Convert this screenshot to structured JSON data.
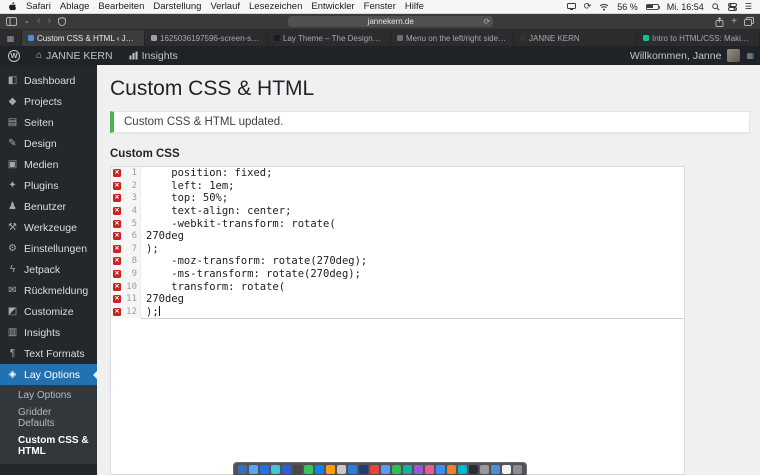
{
  "colors": {
    "wp_blue": "#2271b1",
    "notice_green": "#46b450",
    "error_red": "#cc2222"
  },
  "menubar": {
    "menus": [
      "Safari",
      "Ablage",
      "Bearbeiten",
      "Darstellung",
      "Verlauf",
      "Lesezeichen",
      "Entwickler",
      "Fenster",
      "Hilfe"
    ],
    "status_icons": [
      "display-icon",
      "sync-icon",
      "wifi-icon",
      "battery-icon",
      "spotlight-icon",
      "control-center-icon",
      "notification-icon"
    ],
    "battery": "56 %",
    "clock": "Mi. 16:54"
  },
  "browser": {
    "address": "jannekern.de",
    "tabs": [
      {
        "title": "Custom CSS & HTML ‹ JANN...",
        "color": "#4a90d9",
        "active": true,
        "name": "custom-css-html"
      },
      {
        "title": "1625036197596-screen-shot...",
        "color": "#9aa0a6",
        "name": "screenshot-image"
      },
      {
        "title": "Lay Theme – The Designer's...",
        "color": "#1c1c1e",
        "name": "lay-theme"
      },
      {
        "title": "Menu on the left/right side! |...",
        "color": "#6e6e73",
        "name": "menu-left-right-side"
      },
      {
        "title": "JANNE KERN",
        "color": "#333336",
        "name": "janne-kern"
      },
      {
        "title": "Intro to HTML/CSS: Making w...",
        "color": "#14bf96",
        "name": "intro-html-css"
      }
    ]
  },
  "adminbar": {
    "site_name": "JANNE KERN",
    "insights_label": "Insights",
    "welcome": "Willkommen, Janne"
  },
  "sidebar": {
    "items": [
      {
        "label": "Dashboard",
        "icon": "◧",
        "icon_name": "dashboard-icon",
        "name": "dashboard"
      },
      {
        "label": "Projects",
        "icon": "◆",
        "icon_name": "projects-icon",
        "name": "projects"
      },
      {
        "label": "Seiten",
        "icon": "▤",
        "icon_name": "pages-icon",
        "name": "seiten"
      },
      {
        "label": "Design",
        "icon": "✎",
        "icon_name": "design-icon",
        "name": "design"
      },
      {
        "label": "Medien",
        "icon": "▣",
        "icon_name": "media-icon",
        "name": "medien"
      },
      {
        "label": "Plugins",
        "icon": "✦",
        "icon_name": "plugins-icon",
        "name": "plugins"
      },
      {
        "label": "Benutzer",
        "icon": "♟",
        "icon_name": "users-icon",
        "name": "benutzer"
      },
      {
        "label": "Werkzeuge",
        "icon": "⚒",
        "icon_name": "tools-icon",
        "name": "werkzeuge"
      },
      {
        "label": "Einstellungen",
        "icon": "⚙",
        "icon_name": "settings-icon",
        "name": "einstellungen"
      },
      {
        "label": "Jetpack",
        "icon": "ϟ",
        "icon_name": "jetpack-icon",
        "name": "jetpack"
      },
      {
        "label": "Rückmeldung",
        "icon": "✉",
        "icon_name": "feedback-icon",
        "name": "rueckmeldung"
      },
      {
        "label": "Customize",
        "icon": "◩",
        "icon_name": "customize-icon",
        "name": "customize"
      },
      {
        "label": "Insights",
        "icon": "▥",
        "icon_name": "insights-icon",
        "name": "insights"
      },
      {
        "label": "Text Formats",
        "icon": "¶",
        "icon_name": "text-formats-icon",
        "name": "text-formats"
      },
      {
        "label": "Lay Options",
        "icon": "◈",
        "icon_name": "lay-options-icon",
        "name": "lay-options",
        "active": true
      }
    ],
    "submenu": [
      {
        "label": "Lay Options",
        "name": "lay-options"
      },
      {
        "label": "Gridder Defaults",
        "name": "gridder-defaults"
      },
      {
        "label": "Custom CSS & HTML",
        "name": "custom-css-html",
        "current": true
      }
    ]
  },
  "page": {
    "title": "Custom CSS & HTML",
    "notice": "Custom CSS & HTML updated.",
    "editor_label": "Custom CSS",
    "code": [
      {
        "n": 1,
        "text": "    position: fixed;"
      },
      {
        "n": 2,
        "text": "    left: 1em;"
      },
      {
        "n": 3,
        "text": "    top: 50%;"
      },
      {
        "n": 4,
        "text": "    text-align: center;"
      },
      {
        "n": 5,
        "text": "    -webkit-transform: rotate("
      },
      {
        "n": 6,
        "text": "270deg"
      },
      {
        "n": 7,
        "text": ");"
      },
      {
        "n": 8,
        "text": "    -moz-transform: rotate(270deg);"
      },
      {
        "n": 9,
        "text": "    -ms-transform: rotate(270deg);"
      },
      {
        "n": 10,
        "text": "    transform: rotate("
      },
      {
        "n": 11,
        "text": "270deg"
      },
      {
        "n": 12,
        "text": ");",
        "cursor": true
      }
    ]
  },
  "dock": {
    "apps": [
      {
        "color": "#3a6fb5"
      },
      {
        "color": "#57a8f0"
      },
      {
        "color": "#1f72e8"
      },
      {
        "color": "#41c7d8"
      },
      {
        "color": "#2b5fd9"
      },
      {
        "color": "#48484a"
      },
      {
        "color": "#35c75a"
      },
      {
        "color": "#0a84ff"
      },
      {
        "color": "#ff9f0a"
      },
      {
        "color": "#c7c7cc"
      },
      {
        "color": "#2a7de1"
      },
      {
        "color": "#1c3f6e"
      },
      {
        "color": "#e8453c"
      },
      {
        "color": "#5a9cf8"
      },
      {
        "color": "#2ebd59"
      },
      {
        "color": "#12b2a0"
      },
      {
        "color": "#9b59d0"
      },
      {
        "color": "#e85d8a"
      },
      {
        "color": "#3f8cff"
      },
      {
        "color": "#f07f2e"
      },
      {
        "color": "#00b8d4"
      },
      {
        "color": "#2c2c2e"
      },
      {
        "color": "#98989d"
      },
      {
        "color": "#4a90d9"
      },
      {
        "color": "#f2f2f4"
      },
      {
        "color": "#8e8e93"
      }
    ]
  }
}
